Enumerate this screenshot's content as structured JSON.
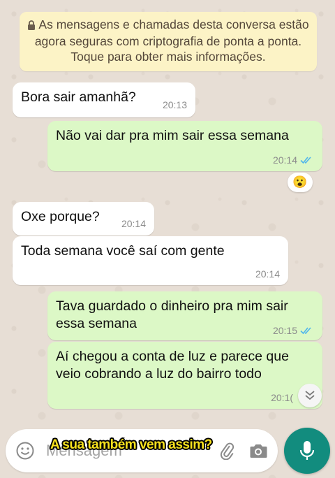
{
  "notice": {
    "text": "As mensagens e chamadas desta conversa estão agora seguras com criptografia de ponta a ponta. Toque para obter mais informações."
  },
  "messages": [
    {
      "direction": "in",
      "text": "Bora sair amanhã?",
      "time": "20:13"
    },
    {
      "direction": "out",
      "text": "Não vai dar pra mim sair essa semana",
      "time": "20:14",
      "status": "read"
    },
    {
      "direction": "in",
      "text": "Oxe porque?",
      "time": "20:14"
    },
    {
      "direction": "in",
      "text": "Toda semana você saí com gente",
      "time": "20:14"
    },
    {
      "direction": "out",
      "lines": [
        "Tava guardado o dinheiro pra mim sair",
        "essa semana"
      ],
      "time": "20:15",
      "status": "read"
    },
    {
      "direction": "out",
      "lines": [
        "Aí chegou a conta de luz e parece que",
        "veio cobrando a luz do bairro todo"
      ],
      "time": "20:1("
    }
  ],
  "reaction": {
    "emoji": "😮"
  },
  "composer": {
    "placeholder": "Mensagem",
    "caption": "A sua também vem assim?"
  },
  "colors": {
    "outgoing": "#dcf8c6",
    "incoming": "#ffffff",
    "notice": "#fcf3c6",
    "accent": "#128c7e",
    "read_ticks": "#4fb6ec"
  },
  "icons": [
    "lock-icon",
    "read-ticks-icon",
    "chevron-down-icon",
    "emoji-icon",
    "attach-icon",
    "camera-icon",
    "mic-icon"
  ]
}
